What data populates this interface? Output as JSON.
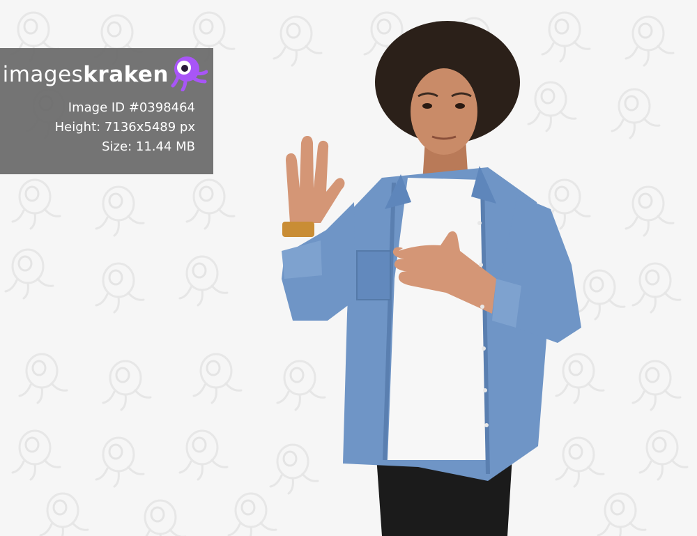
{
  "brand": {
    "name_light": "images",
    "name_bold": "kraken",
    "logo_icon": "kraken-mascot-icon",
    "accent_color": "#a855f7"
  },
  "image_info": {
    "id": "Image ID #0398464",
    "height": "Height: 7136x5489 px",
    "size": "Size: 11.44 MB"
  },
  "scene": {
    "background_color": "#f6f6f6",
    "shirt_color": "#6f95c6",
    "tee_color": "#f7f7f7",
    "pants_color": "#1a1a1a",
    "skin_color": "#c98b68",
    "hair_color": "#2a201a",
    "watch_color": "#c98d35"
  }
}
